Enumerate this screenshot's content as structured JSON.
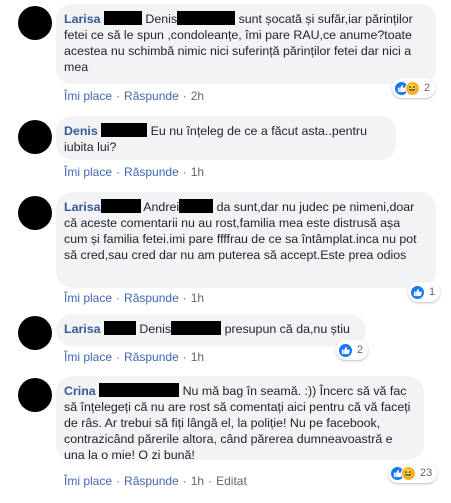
{
  "comments": [
    {
      "name": "Larisa",
      "text_before": "Denis",
      "text": "sunt șocată și sufăr,iar părinților fetei ce să le spun ,condoleanțe, îmi pare RAU,ce anume?toate acestea nu schimbă nimic nici suferință părinților fetei dar nici a mea",
      "reaction_count": "2",
      "reactions": [
        "like-icon",
        "haha-icon"
      ],
      "like_label": "Îmi place",
      "reply_label": "Răspunde",
      "time": "2h"
    },
    {
      "name": "Denis",
      "text": "Eu nu înțeleg de ce a făcut asta..pentru iubita lui?",
      "like_label": "Îmi place",
      "reply_label": "Răspunde",
      "time": "1h"
    },
    {
      "name": "Larisa",
      "text_before": "Andrei",
      "text": "da sunt,dar nu judec pe nimeni,doar că aceste comentarii nu au rost,familia mea este distrusă așa cum și familia fetei.imi pare ffffrau de ce sa întâmplat.inca nu pot să cred,sau cred dar nu am puterea să accept.Este prea odios",
      "reaction_count": "1",
      "reactions": [
        "like-icon"
      ],
      "like_label": "Îmi place",
      "reply_label": "Răspunde",
      "time": "1h"
    },
    {
      "name": "Larisa",
      "text_before": "Denis",
      "text": "presupun că da,nu știu",
      "reaction_count": "2",
      "reactions": [
        "like-icon"
      ],
      "like_label": "Îmi place",
      "reply_label": "Răspunde",
      "time": "1h"
    },
    {
      "name": "Crina",
      "text": "Nu mă bag în seamă. :)) Încerc să vă fac să înțelegeți că nu are rost să comentați aici pentru că vă faceți de râs. Ar trebui să fiți lângă el, la poliție! Nu pe facebook, contrazicând părerile altora, când părerea dumneavoastră e una la o mie! O zi bună!",
      "reaction_count": "23",
      "reactions": [
        "like-icon",
        "haha-icon"
      ],
      "like_label": "Îmi place",
      "reply_label": "Răspunde",
      "time": "1h",
      "edited_label": "Editat"
    }
  ],
  "colors": {
    "name": "#385898",
    "link": "#4267b2",
    "bubble": "#f2f3f5",
    "meta": "#606770",
    "like": "#1877f2"
  }
}
